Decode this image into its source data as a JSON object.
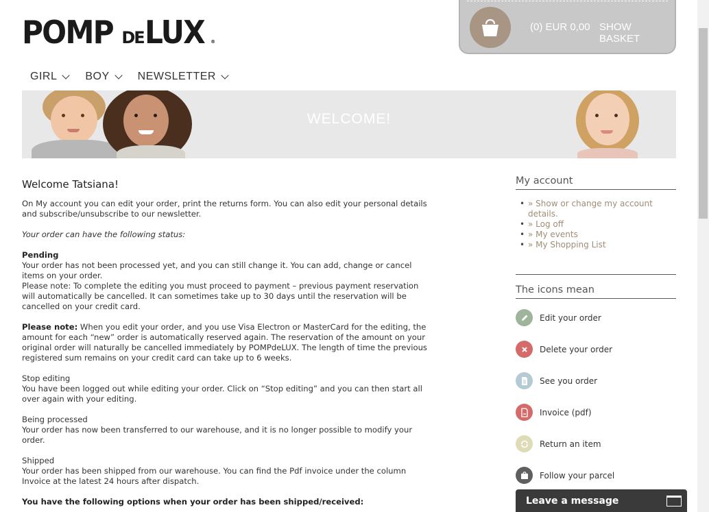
{
  "brand": {
    "big1": "POMP",
    "small": "DE",
    "big2": "LUX",
    "registered": "®"
  },
  "basket": {
    "count_total": "(0) EUR 0,00",
    "show_label": "SHOW BASKET"
  },
  "nav": {
    "items": [
      {
        "label": "GIRL"
      },
      {
        "label": "BOY"
      },
      {
        "label": "NEWSLETTER"
      }
    ]
  },
  "banner": {
    "title": "WELCOME!"
  },
  "main": {
    "heading": "Welcome Tatsiana!",
    "intro": "On My account you can edit your order, print the returns form. You can also edit your personal details and subscribe/unsubscribe to our newsletter.",
    "status_intro": "Your order can have the following status:",
    "pending": {
      "title": "Pending",
      "line1": "Your order has not been processed yet, and you can still change it. You can add, change or cancel items on your order.",
      "line2": "Please note: To complete the editing you must proceed to payment – previous payment reservation will automatically be cancelled. It can sometimes take up to 30 days until the reservation will be cancelled on your credit card."
    },
    "note": {
      "title": "Please note:",
      "text": " When you edit your order, and you use Visa Electron or MasterCard for the editing, the amount for each “new” order is automatically reserved again. The reservation of the amount on your original order will naturally be cancelled immediately by POMPdeLUX. The length of time the previous registered sum remains on your credit card can take up to 6 weeks."
    },
    "stop": {
      "title": "Stop editing",
      "text": "You have been logged out while editing your order. Click on “Stop editing” and you can then start all over again with your editing."
    },
    "processed": {
      "title": "Being processed",
      "text": "Your order has now been transferred to our warehouse, and it is no longer possible to modify your order."
    },
    "shipped": {
      "title": "Shipped",
      "text": "Your order has been shipped from our warehouse. You can find the Pdf invoice under the column Invoice at the latest 24 hours after dispatch."
    },
    "options": "You have the following options when your order has been shipped/received:"
  },
  "sidebar": {
    "account_heading": "My account",
    "links": [
      {
        "label": "» Show or change my account details."
      },
      {
        "label": "» Log off"
      },
      {
        "label": "» My events"
      },
      {
        "label": "» My Shopping List"
      }
    ],
    "icons_heading": "The icons mean",
    "icons": [
      {
        "label": "Edit your order",
        "icon": "pencil-icon",
        "color": "#9fb59b"
      },
      {
        "label": "Delete your order",
        "icon": "close-icon",
        "color": "#d46a6a"
      },
      {
        "label": "See you order",
        "icon": "document-icon",
        "color": "#b4cbd6"
      },
      {
        "label": "Invoice (pdf)",
        "icon": "pdf-icon",
        "color": "#d46a6a"
      },
      {
        "label": "Return an item",
        "icon": "return-icon",
        "color": "#dedcb7"
      },
      {
        "label": "Follow your parcel",
        "icon": "parcel-icon",
        "color": "#5f5f5f"
      }
    ]
  },
  "chat": {
    "label": "Leave a message"
  }
}
